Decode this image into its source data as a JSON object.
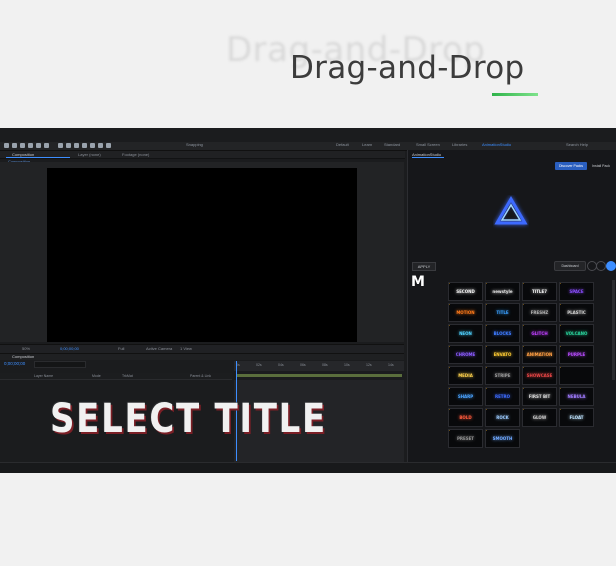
{
  "header": {
    "ghost_title": "Drag-and-Drop",
    "title": "Drag-and-Drop"
  },
  "colors": {
    "accent": "#3d8eff",
    "underline": "#2fb34a",
    "select_shadow": "#7b1f26",
    "badge": "#e3a321"
  },
  "app": {
    "toolbar": {
      "snapping": "Snapping",
      "workspaces": [
        "Default",
        "Learn",
        "Standard",
        "Small Screen",
        "Libraries",
        "AnimationStudio"
      ],
      "search": "Search Help"
    },
    "tabs": [
      {
        "label": "Composition",
        "active": true
      },
      {
        "label": "Layer (none)",
        "active": false
      },
      {
        "label": "Footage (none)",
        "active": false
      }
    ],
    "breadcrumb": "Composition",
    "viewer_footer": {
      "zoom": "50%",
      "time": "0;00;00;00",
      "quality": "Full",
      "camera": "Active Camera",
      "views": "1 View"
    },
    "timeline": {
      "tab": "Composition",
      "timecode": "0;00;00;00",
      "columns": [
        "Layer Name",
        "Mode",
        "TrkMat",
        "Parent & Link"
      ],
      "ruler": [
        "0s",
        "02s",
        "04s",
        "06s",
        "08s",
        "10s",
        "12s",
        "14s"
      ]
    },
    "overlay_text": "SELECT TITLE"
  },
  "panel": {
    "title": "AnimationStudio",
    "discover_label": "Discover Packs",
    "install_label": "Install Pack",
    "apply_label": "APPLY",
    "dashboard_label": "Dashboard",
    "logo_letter": "M",
    "tiles": [
      {
        "label": "SECOND",
        "color": "#f2f2f2"
      },
      {
        "label": "newstyle",
        "color": "#e0e0e0"
      },
      {
        "label": "TITLE7",
        "color": "#f5f5f5"
      },
      {
        "label": "SPACE",
        "color": "#8a4dff"
      },
      {
        "label": "MOTION",
        "color": "#ff7a1a"
      },
      {
        "label": "TITLE",
        "color": "#3aa0ff"
      },
      {
        "label": "FRESHZ",
        "color": "#b0b0b0"
      },
      {
        "label": "PLASTIC",
        "color": "#d0d0d0"
      },
      {
        "label": "NEON",
        "color": "#4fd2ff"
      },
      {
        "label": "BLOCKS",
        "color": "#3e7bff"
      },
      {
        "label": "GLITCH",
        "color": "#c040ff"
      },
      {
        "label": "VOLCANO",
        "color": "#29d29b"
      },
      {
        "label": "CHROME",
        "color": "#8b5bff"
      },
      {
        "label": "ENVATO",
        "color": "#ffcc33"
      },
      {
        "label": "ANIMATION",
        "color": "#ff9f43"
      },
      {
        "label": "PURPLE",
        "color": "#b84cff"
      },
      {
        "label": "MEDIA",
        "color": "#ffd34d"
      },
      {
        "label": "STRIPE",
        "color": "#9a9a9a"
      },
      {
        "label": "SHOWCASE",
        "color": "#e64545"
      },
      {
        "label": "",
        "color": "#333333"
      },
      {
        "label": "SHARP",
        "color": "#4aa3ff"
      },
      {
        "label": "RETRO",
        "color": "#3d6bff"
      },
      {
        "label": "FIRST BIT",
        "color": "#dcdcdc"
      },
      {
        "label": "NEBULA",
        "color": "#a07bff"
      },
      {
        "label": "BOLD",
        "color": "#ff5a3c"
      },
      {
        "label": "ROCK",
        "color": "#9ccbff"
      },
      {
        "label": "GLOW",
        "color": "#c9c9c9"
      },
      {
        "label": "FLOAT",
        "color": "#bfe4ff"
      },
      {
        "label": "PRESET",
        "color": "#8f8f8f"
      },
      {
        "label": "SMOOTH",
        "color": "#6fa8ff"
      }
    ]
  }
}
